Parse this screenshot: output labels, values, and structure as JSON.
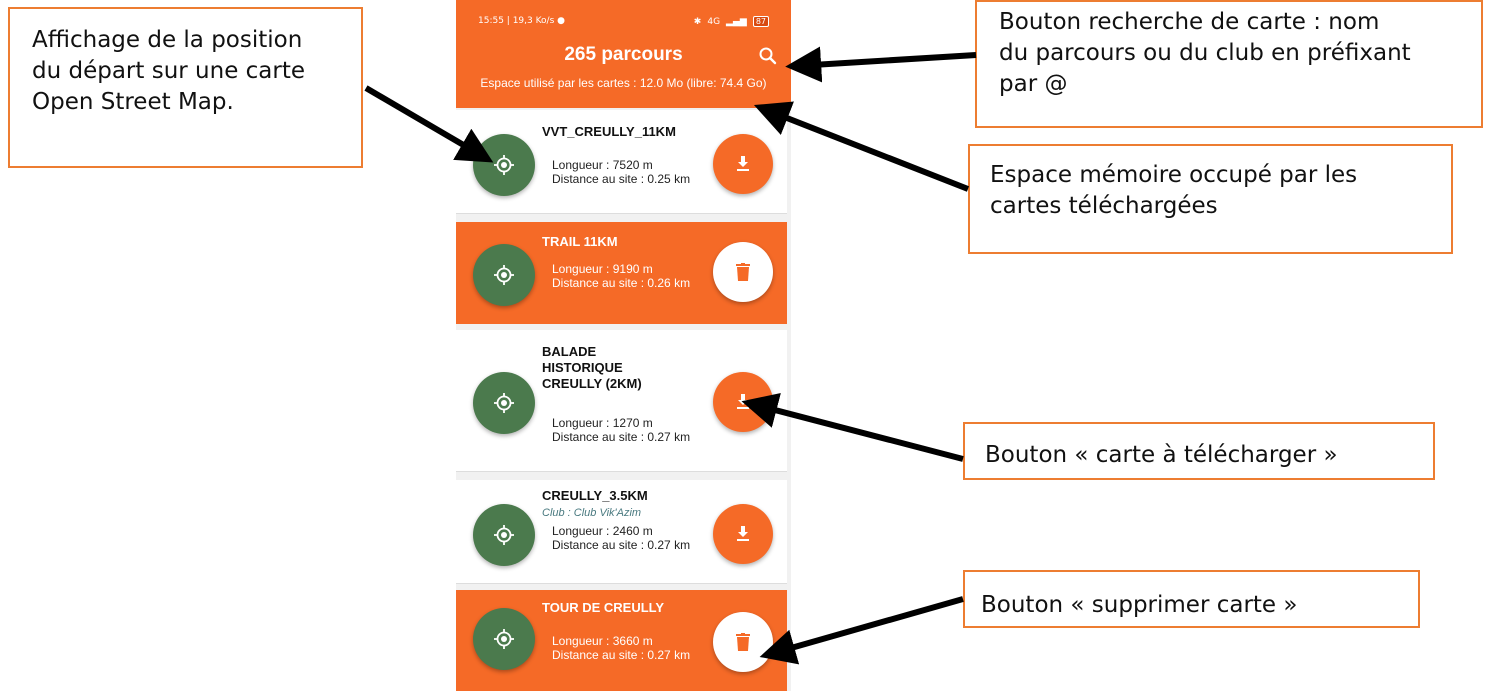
{
  "callouts": {
    "osm": [
      "Affichage de la position",
      "du départ sur une carte",
      "Open Street Map."
    ],
    "search": [
      "Bouton recherche de carte : nom",
      "du parcours ou du club en préfixant",
      "par @"
    ],
    "space": [
      "Espace mémoire occupé par les",
      "cartes téléchargées"
    ],
    "download": [
      "Bouton « carte à télécharger »"
    ],
    "delete": [
      "Bouton « supprimer carte »"
    ]
  },
  "phone": {
    "status_left": "15:55 | 19,3 Ko/s",
    "status_right": "4G",
    "battery": "87",
    "title": "265 parcours",
    "storage": "Espace utilisé par les cartes : 12.0 Mo (libre: 74.4 Go)",
    "cards": [
      {
        "title": "VVT_CREULLY_11KM",
        "club": "",
        "length": "Longueur : 7520 m",
        "distance": "Distance au site : 0.25 km",
        "action": "download"
      },
      {
        "title": "TRAIL 11KM",
        "club": "",
        "length": "Longueur : 9190 m",
        "distance": "Distance au site : 0.26 km",
        "action": "delete"
      },
      {
        "title": "BALADE HISTORIQUE CREULLY (2KM)",
        "club": "",
        "length": "Longueur : 1270 m",
        "distance": "Distance au site : 0.27 km",
        "action": "download"
      },
      {
        "title": "CREULLY_3.5KM",
        "club": "Club : Club Vik'Azim",
        "length": "Longueur : 2460 m",
        "distance": "Distance au site : 0.27 km",
        "action": "download"
      },
      {
        "title": "TOUR DE CREULLY",
        "club": "",
        "length": "Longueur : 3660 m",
        "distance": "Distance au site : 0.27 km",
        "action": "delete"
      }
    ]
  },
  "colors": {
    "accent": "#F56A27",
    "locate_button": "#4B7A4D",
    "callout_border": "#ED7D31"
  }
}
